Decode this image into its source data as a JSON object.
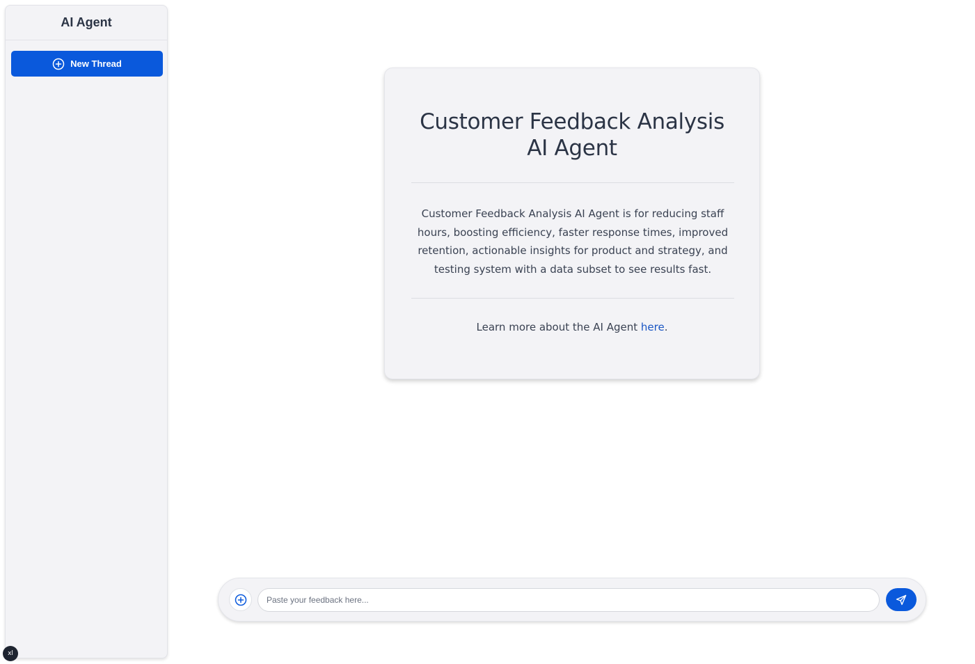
{
  "sidebar": {
    "title": "AI Agent",
    "new_thread_label": "New Thread"
  },
  "card": {
    "title": "Customer Feedback Analysis AI Agent",
    "description": "Customer Feedback Analysis AI Agent is for reducing staff hours, boosting efficiency, faster response times, improved retention, actionable insights for product and strategy, and testing system with a data subset to see results fast.",
    "learn_prefix": "Learn more about the AI Agent ",
    "learn_link": "here",
    "learn_suffix": "."
  },
  "composer": {
    "placeholder": "Paste your feedback here...",
    "value": ""
  },
  "badge": {
    "label": "xl"
  },
  "icons": {
    "new_thread": "plus-circle-icon",
    "attach": "plus-circle-icon",
    "send": "send-icon"
  },
  "colors": {
    "primary": "#0a59dc",
    "link": "#1a56c4",
    "panel_bg": "#f3f3f6",
    "text": "#2b3445"
  }
}
